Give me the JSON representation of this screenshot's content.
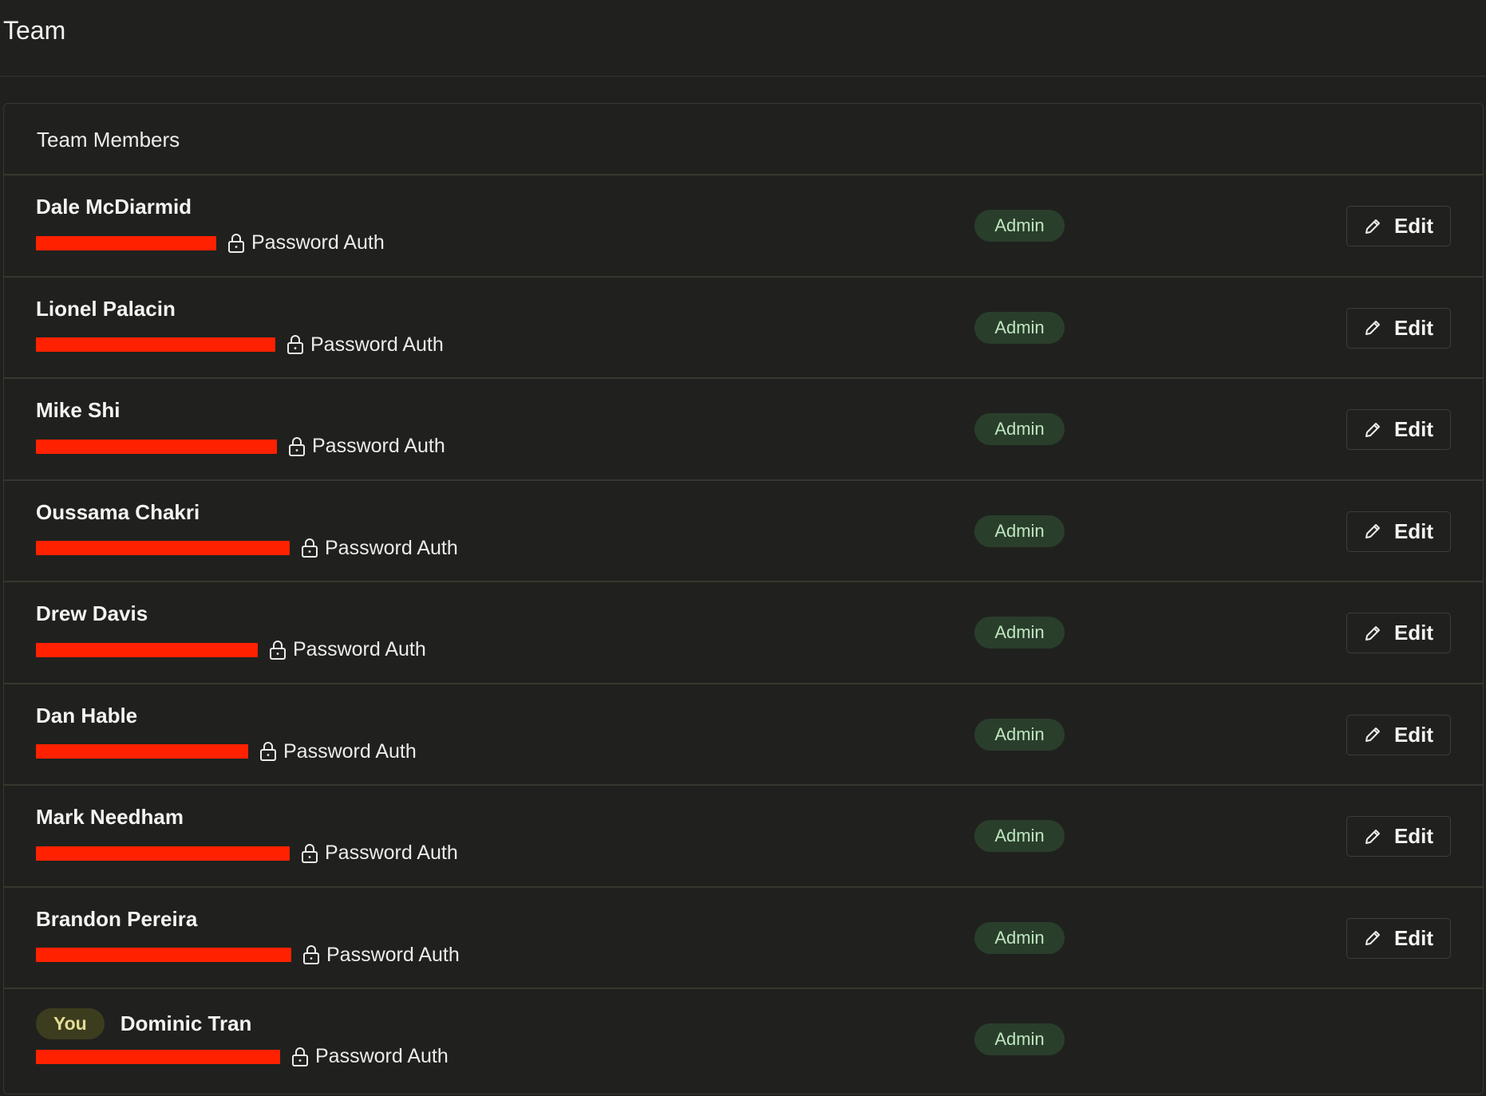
{
  "page": {
    "title": "Team"
  },
  "panel": {
    "title": "Team Members"
  },
  "members": [
    {
      "name": "Dale McDiarmid",
      "auth": "Password Auth",
      "role": "Admin",
      "edit": "Edit",
      "is_you": false
    },
    {
      "name": "Lionel Palacin",
      "auth": "Password Auth",
      "role": "Admin",
      "edit": "Edit",
      "is_you": false
    },
    {
      "name": "Mike Shi",
      "auth": "Password Auth",
      "role": "Admin",
      "edit": "Edit",
      "is_you": false
    },
    {
      "name": "Oussama Chakri",
      "auth": "Password Auth",
      "role": "Admin",
      "edit": "Edit",
      "is_you": false
    },
    {
      "name": "Drew Davis",
      "auth": "Password Auth",
      "role": "Admin",
      "edit": "Edit",
      "is_you": false
    },
    {
      "name": "Dan Hable",
      "auth": "Password Auth",
      "role": "Admin",
      "edit": "Edit",
      "is_you": false
    },
    {
      "name": "Mark Needham",
      "auth": "Password Auth",
      "role": "Admin",
      "edit": "Edit",
      "is_you": false
    },
    {
      "name": "Brandon Pereira",
      "auth": "Password Auth",
      "role": "Admin",
      "edit": "Edit",
      "is_you": false
    },
    {
      "name": "Dominic Tran",
      "auth": "Password Auth",
      "role": "Admin",
      "edit": "",
      "is_you": true,
      "you_label": "You"
    }
  ],
  "icons": {
    "auth": "lock-icon",
    "edit": "pencil-icon"
  },
  "colors": {
    "background": "#20211e",
    "role_badge": "#2a3e2c",
    "role_text": "#bfe6c0",
    "redaction": "#ff2100",
    "you_badge": "#3c3d1f"
  }
}
